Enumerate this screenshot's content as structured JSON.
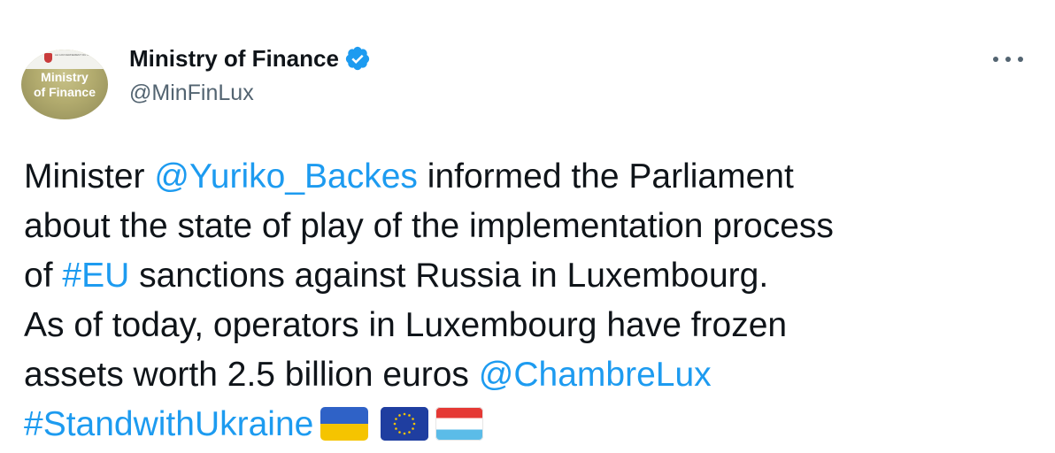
{
  "author": {
    "name": "Ministry of Finance",
    "handle": "@MinFinLux",
    "verified": true,
    "avatar_text_line1": "Ministry",
    "avatar_text_line2": "of Finance",
    "avatar_small_text": "LE GOUVERNEMENT DU GRAND-DUCHÉ DE LUXEMBOURG",
    "avatar_colors": {
      "top": "#f2f2ee",
      "body": "#b2ab6e",
      "crest": "#c93b3b"
    }
  },
  "menu": {
    "icon": "more-horizontal-icon"
  },
  "tweet": {
    "line1_a": "Minister ",
    "mention1": "@Yuriko_Backes",
    "line1_b": " informed the Parliament",
    "line2": "about the state of play of the implementation process",
    "line3_a": "of ",
    "hashtag1": "#EU",
    "line3_b": " sanctions against Russia in Luxembourg.",
    "line4": "As of today, operators in Luxembourg have frozen",
    "line5_a": "assets worth 2.5 billion euros ",
    "mention2": "@ChambreLux",
    "hashtag2": "#StandwithUkraine",
    "flags": [
      "flag-ukraine-icon",
      "flag-eu-icon",
      "flag-luxembourg-icon"
    ]
  },
  "colors": {
    "text": "#0f1419",
    "secondary": "#536471",
    "link": "#1d9bf0",
    "verified": "#1d9bf0"
  }
}
